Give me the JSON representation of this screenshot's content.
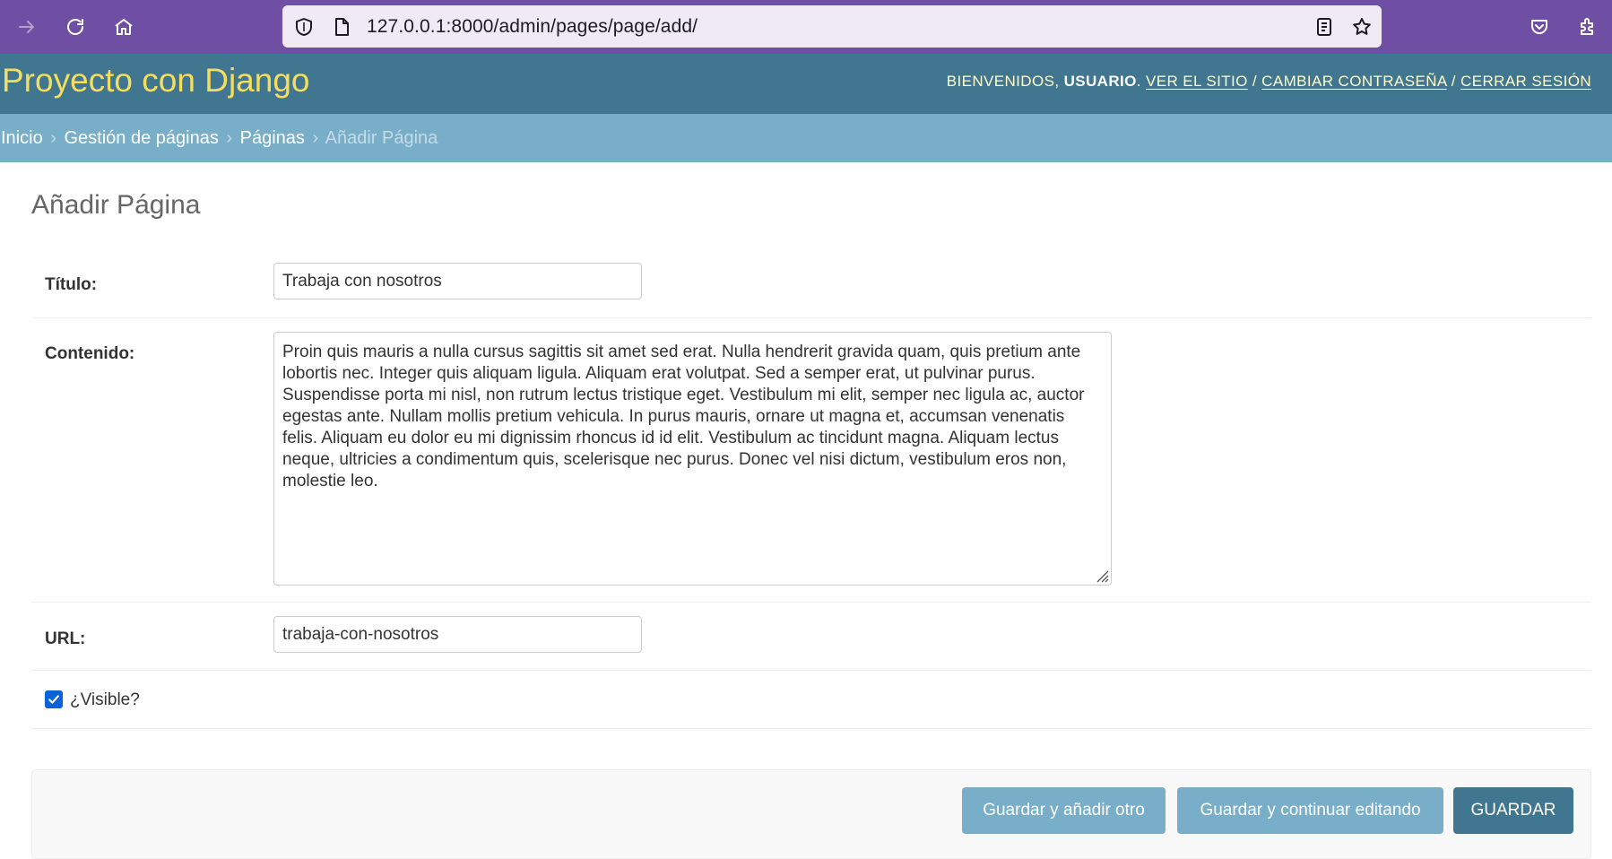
{
  "browser": {
    "url_host": "127.0.0.1",
    "url_rest": ":8000/admin/pages/page/add/"
  },
  "header": {
    "branding": "Proyecto con Django",
    "welcome": "Bienvenidos,",
    "username": "usuario",
    "view_site": "Ver el sitio",
    "change_password": "Cambiar contraseña",
    "logout": "Cerrar sesión",
    "separator": "/"
  },
  "breadcrumbs": {
    "home": "Inicio",
    "app": "Gestión de páginas",
    "model": "Páginas",
    "current": "Añadir Página",
    "sep": "›"
  },
  "page": {
    "title": "Añadir Página"
  },
  "form": {
    "titulo_label": "Título:",
    "titulo_value": "Trabaja con nosotros",
    "contenido_label": "Contenido:",
    "contenido_value": "Proin quis mauris a nulla cursus sagittis sit amet sed erat. Nulla hendrerit gravida quam, quis pretium ante lobortis nec. Integer quis aliquam ligula. Aliquam erat volutpat. Sed a semper erat, ut pulvinar purus. Suspendisse porta mi nisl, non rutrum lectus tristique eget. Vestibulum mi elit, semper nec ligula ac, auctor egestas ante. Nullam mollis pretium vehicula. In purus mauris, ornare ut magna et, accumsan venenatis felis. Aliquam eu dolor eu mi dignissim rhoncus id id elit. Vestibulum ac tincidunt magna. Aliquam lectus neque, ultricies a condimentum quis, scelerisque nec purus. Donec vel nisi dictum, vestibulum eros non, molestie leo.",
    "url_label": "URL:",
    "url_value": "trabaja-con-nosotros",
    "visible_label": "¿Visible?",
    "visible_checked": true
  },
  "buttons": {
    "save_add_another": "Guardar y añadir otro",
    "save_continue": "Guardar y continuar editando",
    "save": "Guardar"
  },
  "colors": {
    "browser_chrome": "#6f4fa3",
    "header_bg": "#417690",
    "branding": "#f5dd5d",
    "breadcrumbs_bg": "#79aec8",
    "checkbox": "#0b62d6"
  }
}
